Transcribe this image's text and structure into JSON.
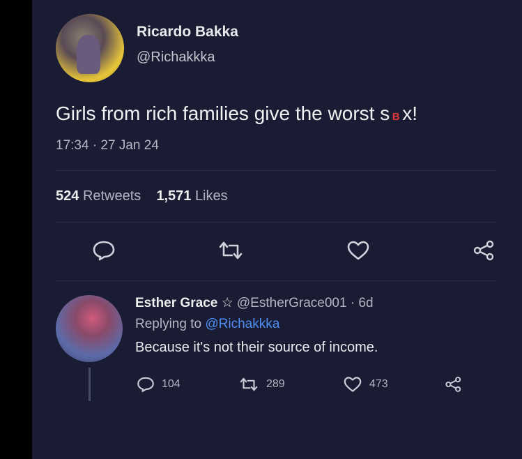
{
  "tweet": {
    "display_name": "Ricardo Bakka",
    "handle": "@Richakkka",
    "text_before": "Girls from rich families give the worst s",
    "text_censor": "B",
    "text_after": "x!",
    "timestamp": "17:34 · 27 Jan 24",
    "stats": {
      "retweets_count": "524",
      "retweets_label": "Retweets",
      "likes_count": "1,571",
      "likes_label": "Likes"
    },
    "icons": [
      "reply-icon",
      "retweet-icon",
      "like-icon",
      "share-icon"
    ]
  },
  "reply": {
    "display_name": "Esther Grace ☆",
    "handle_meta": "@EstherGrace001 · 6d",
    "replying_prefix": "Replying to",
    "replying_handle": "@Richakkka",
    "text": "Because it's not their source of income.",
    "reply_count": "104",
    "retweet_count": "289",
    "like_count": "473"
  },
  "colors": {
    "background": "#1a1c33",
    "text_primary": "#eeeeef",
    "text_secondary": "#b4b6c2",
    "mention": "#4e8ff2",
    "censor": "#e23a3a"
  }
}
